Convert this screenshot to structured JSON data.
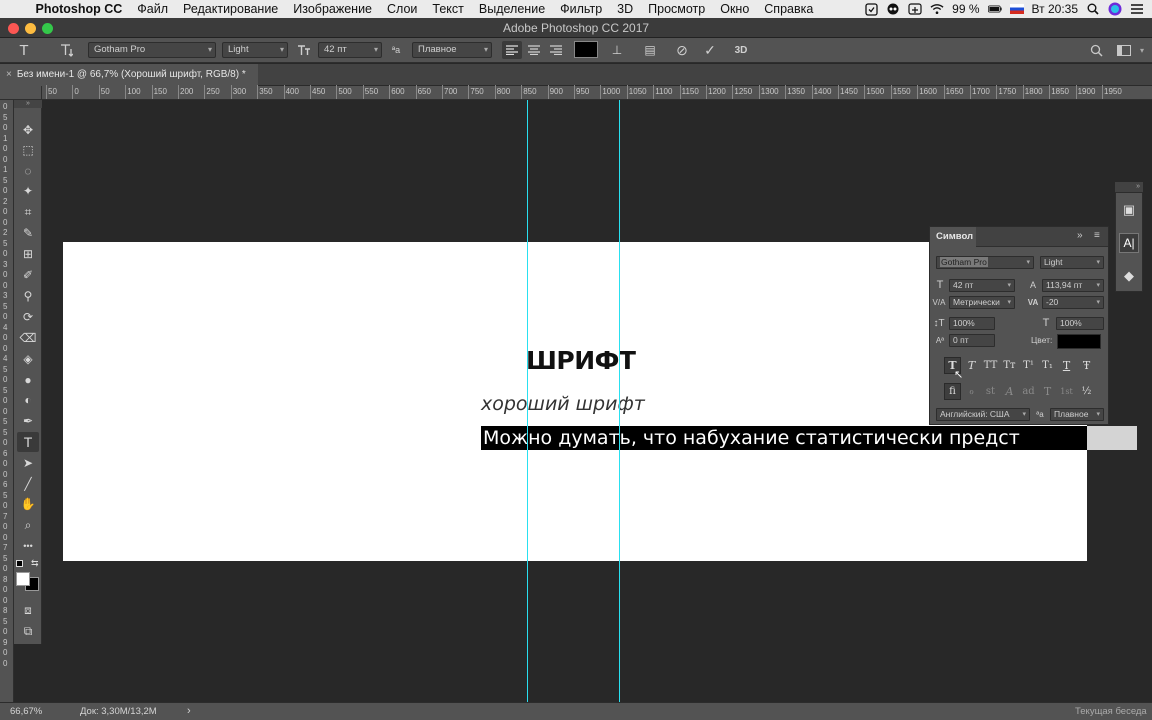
{
  "menubar": {
    "apple_glyph": "",
    "app": "Photoshop CC",
    "items": [
      "Файл",
      "Редактирование",
      "Изображение",
      "Слои",
      "Текст",
      "Выделение",
      "Фильтр",
      "3D",
      "Просмотр",
      "Окно",
      "Справка"
    ],
    "battery": "99 %",
    "clock": "Вт 20:35"
  },
  "window": {
    "title": "Adobe Photoshop CC 2017"
  },
  "options": {
    "font_family": "Gotham Pro",
    "font_style": "Light",
    "font_size": "42 пт",
    "aa_glyph": "ªa",
    "antialias": "Плавное",
    "color": "#000000"
  },
  "document": {
    "tab_title": "Без имени-1 @ 66,7% (Хороший шрифт, RGB/8) *",
    "close_glyph": "×"
  },
  "ruler": {
    "h_labels": [
      "50",
      "0",
      "50",
      "100",
      "150",
      "200",
      "250",
      "300",
      "350",
      "400",
      "450",
      "500",
      "550",
      "600",
      "650",
      "700",
      "750",
      "800",
      "850",
      "900",
      "950",
      "1000",
      "1050",
      "1100",
      "1150",
      "1200",
      "1250",
      "1300",
      "1350",
      "1400",
      "1450",
      "1500",
      "1550",
      "1600",
      "1650",
      "1700",
      "1750",
      "1800",
      "1850",
      "1900",
      "1950"
    ],
    "v_labels": [
      "0",
      "5",
      "0",
      "1",
      "0",
      "0",
      "1",
      "5",
      "0",
      "2",
      "0",
      "0",
      "2",
      "5",
      "0",
      "3",
      "0",
      "0",
      "3",
      "5",
      "0",
      "4",
      "0",
      "0",
      "4",
      "5",
      "0",
      "5",
      "0",
      "0",
      "5",
      "5",
      "0",
      "6",
      "0",
      "0",
      "6",
      "5",
      "0",
      "7",
      "0",
      "0",
      "7",
      "5",
      "0",
      "8",
      "0",
      "0",
      "8",
      "5",
      "0",
      "9",
      "0",
      "0"
    ]
  },
  "canvas": {
    "heading": "ШРИФТ",
    "subheading": "хороший шрифт",
    "body": "Можно думать, что набухание статистически предст"
  },
  "character_panel": {
    "title": "Символ",
    "expand_glyph": "»",
    "menu_glyph": "≡",
    "font_family": "Gotham Pro",
    "font_style": "Light",
    "size": "42 пт",
    "leading": "113,94 пт",
    "kerning": "Метрически",
    "tracking": "-20",
    "vscale": "100%",
    "hscale": "100%",
    "baseline": "0 пт",
    "color_label": "Цвет:",
    "language": "Английский: США",
    "aa_glyph": "ªa",
    "antialias": "Плавное",
    "labels": {
      "size": "T",
      "leading": "A",
      "kerning": "V/A",
      "tracking": "VA",
      "vscale": "↕T",
      "hscale": "T",
      "baseline": "Aª"
    },
    "style_buttons": [
      "T",
      "T",
      "TT",
      "Tт",
      "T¹",
      "T₁",
      "T",
      "Ŧ"
    ],
    "opentype_buttons": [
      "fi",
      "ℴ",
      "st",
      "A",
      "ad",
      "T",
      "1st",
      "½"
    ]
  },
  "status": {
    "zoom": "66,67%",
    "doc_info": "Док: 3,30М/13,2М",
    "arrow": "›",
    "right": "Текущая беседа"
  },
  "icons": {
    "text_tool": "T",
    "orientation": "⇅T",
    "align_left": "≡",
    "align_center": "≡",
    "align_right": "≡",
    "warp": "⊥",
    "panels": "▤",
    "cancel": "⊘",
    "commit": "✓",
    "three_d": "3D",
    "search": "⌕",
    "workspace": "▭",
    "move": "✥",
    "marquee": "⬚",
    "lasso": "◌",
    "quick_select": "✦",
    "crop": "⌗",
    "eyedropper": "✎",
    "frame": "⊞",
    "brush": "✐",
    "stamp": "⚲",
    "history_brush": "⟳",
    "eraser": "⌫",
    "bucket": "◈",
    "blur": "●",
    "dodge": "◐",
    "pen": "✒",
    "type": "T",
    "path_select": "➤",
    "line": "╱",
    "hand": "✋",
    "zoom": "⌕",
    "more": "•••",
    "quickmask": "⧈",
    "screenmode": "⧉",
    "dock_properties": "▣",
    "dock_character": "A|",
    "dock_layers": "◆",
    "collapse": "»",
    "close": "×"
  },
  "colors": {
    "guide": "#29e0f0",
    "selection_bg": "#000000",
    "selection_fg": "#ffffff"
  }
}
